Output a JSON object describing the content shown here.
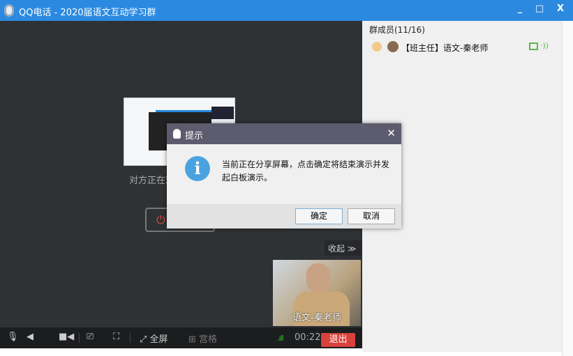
{
  "window": {
    "title": "QQ电话 - 2020届语文互动学习群",
    "minimize": "_",
    "maximize": "□",
    "close": "X"
  },
  "main": {
    "watching_text": "对方正在观",
    "stop_icon": "power-icon",
    "collapse_label": "收起 ≫",
    "video_name": "语文-秦老师"
  },
  "toolbar": {
    "fullscreen": "全屏",
    "grid": "宫格",
    "signal": ".ıll",
    "timer": "00:22",
    "exit": "退出"
  },
  "panel": {
    "header": "群成员(11/16)",
    "members": [
      {
        "name": "【班主任】语文-秦老师"
      }
    ]
  },
  "dialog": {
    "title": "提示",
    "message": "当前正在分享屏幕，点击确定将结束演示并发起白板演示。",
    "ok": "确定",
    "cancel": "取消",
    "close": "✕",
    "info": "i"
  }
}
